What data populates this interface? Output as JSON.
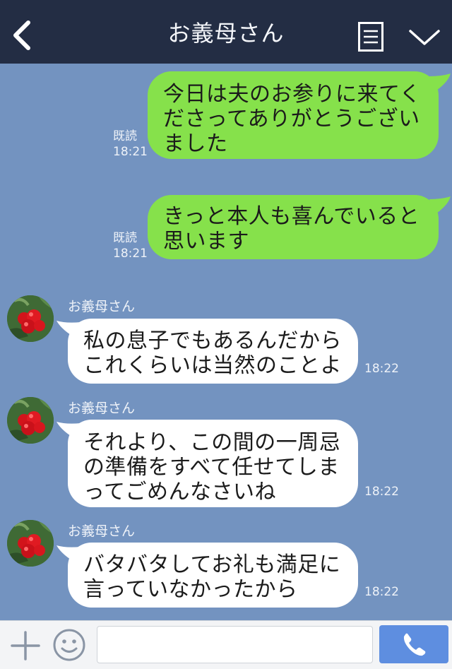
{
  "header": {
    "title": "お義母さん",
    "colors": {
      "background": "#232d44",
      "chat_background": "#7393c0"
    }
  },
  "messages": {
    "m1": {
      "text": "今日は夫のお参りに来てく\nださってありがとうござい\nました",
      "read": "既読",
      "time": "18:21"
    },
    "m2": {
      "text": "きっと本人も喜んでいると\n思います",
      "read": "既読",
      "time": "18:21"
    },
    "m3": {
      "sender": "お義母さん",
      "text": "私の息子でもあるんだから\nこれくらいは当然のことよ",
      "time": "18:22"
    },
    "m4": {
      "sender": "お義母さん",
      "text": "それより、この間の一周忌\nの準備をすべて任せてしま\nってごめんなさいね",
      "time": "18:22"
    },
    "m5": {
      "sender": "お義母さん",
      "text": "バタバタしてお礼も満足に\n言っていなかったから",
      "time": "18:22"
    }
  },
  "colors": {
    "sent_bubble": "#86e14b",
    "received_bubble": "#ffffff",
    "send_button": "#5e8ee0"
  },
  "icons": [
    "back-icon",
    "menu-icon",
    "chevron-down-icon",
    "plus-icon",
    "smile-icon",
    "phone-icon"
  ],
  "input": {
    "value": "",
    "placeholder": ""
  }
}
